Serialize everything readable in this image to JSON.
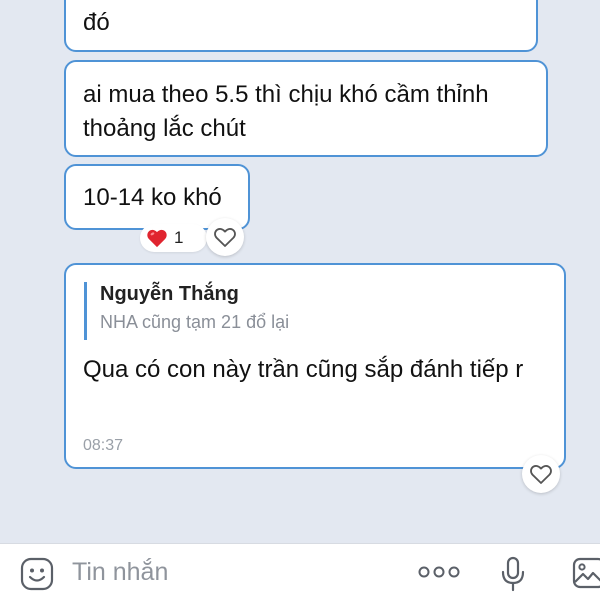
{
  "messages": [
    {
      "text": "đó"
    },
    {
      "text": "ai mua theo 5.5 thì chịu khó cầm thỉnh thoảng lắc chút"
    },
    {
      "text": "10-14 ko khó",
      "reaction": {
        "icon": "heart-icon",
        "count": "1"
      }
    },
    {
      "quote": {
        "name": "Nguyễn Thắng",
        "text": "NHA cũng tạm 21 đổ lại"
      },
      "text": "Qua có con này trần cũng sắp đánh tiếp r",
      "time": "08:37"
    }
  ],
  "composer": {
    "placeholder": "Tin nhắn",
    "icons": [
      "emoji-icon",
      "more-icon",
      "microphone-icon",
      "image-icon"
    ]
  },
  "colors": {
    "background": "#e3e8f1",
    "bubble_border": "#4f93d6",
    "reaction_heart": "#e0242f"
  }
}
